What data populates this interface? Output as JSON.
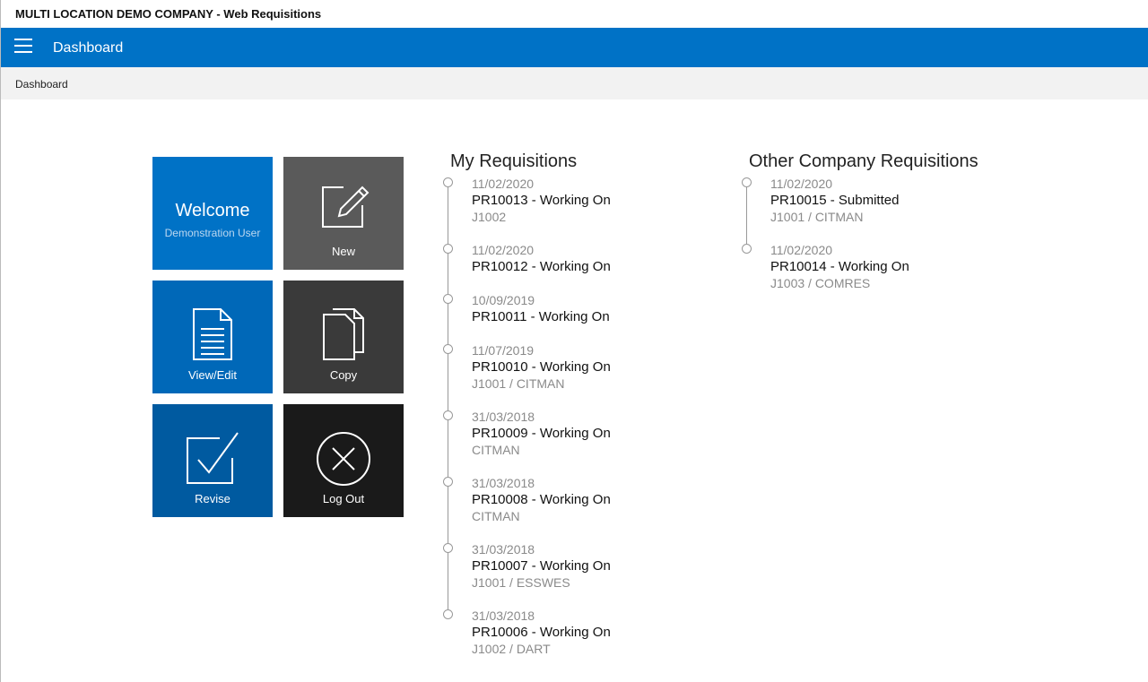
{
  "titlebar": {
    "text": "MULTI LOCATION DEMO COMPANY - Web Requisitions"
  },
  "topnav": {
    "title": "Dashboard"
  },
  "breadcrumb": {
    "text": "Dashboard"
  },
  "tiles": {
    "welcome": {
      "title": "Welcome",
      "subtitle": "Demonstration User"
    },
    "new": {
      "label": "New",
      "icon": "edit-icon"
    },
    "view_edit": {
      "label": "View/Edit",
      "icon": "document-icon"
    },
    "copy": {
      "label": "Copy",
      "icon": "copy-icon"
    },
    "revise": {
      "label": "Revise",
      "icon": "checkbox-icon"
    },
    "log_out": {
      "label": "Log Out",
      "icon": "close-circle-icon"
    }
  },
  "my_requisitions": {
    "title": "My Requisitions",
    "items": [
      {
        "date": "11/02/2020",
        "main": "PR10013 - Working On",
        "sub": "J1002"
      },
      {
        "date": "11/02/2020",
        "main": "PR10012 - Working On",
        "sub": ""
      },
      {
        "date": "10/09/2019",
        "main": "PR10011 - Working On",
        "sub": ""
      },
      {
        "date": "11/07/2019",
        "main": "PR10010 - Working On",
        "sub": "J1001 / CITMAN"
      },
      {
        "date": "31/03/2018",
        "main": "PR10009 - Working On",
        "sub": "CITMAN"
      },
      {
        "date": "31/03/2018",
        "main": "PR10008 - Working On",
        "sub": "CITMAN"
      },
      {
        "date": "31/03/2018",
        "main": "PR10007 - Working On",
        "sub": "J1001 / ESSWES"
      },
      {
        "date": "31/03/2018",
        "main": "PR10006 - Working On",
        "sub": "J1002 / DART"
      }
    ]
  },
  "other_requisitions": {
    "title": "Other Company Requisitions",
    "items": [
      {
        "date": "11/02/2020",
        "main": "PR10015 - Submitted",
        "sub": "J1001 / CITMAN"
      },
      {
        "date": "11/02/2020",
        "main": "PR10014 - Working On",
        "sub": "J1003 / COMRES"
      }
    ]
  },
  "colors": {
    "nav_blue": "#0072c6",
    "breadcrumb_bg": "#f2f2f2",
    "muted_text": "#8a8a8a"
  }
}
